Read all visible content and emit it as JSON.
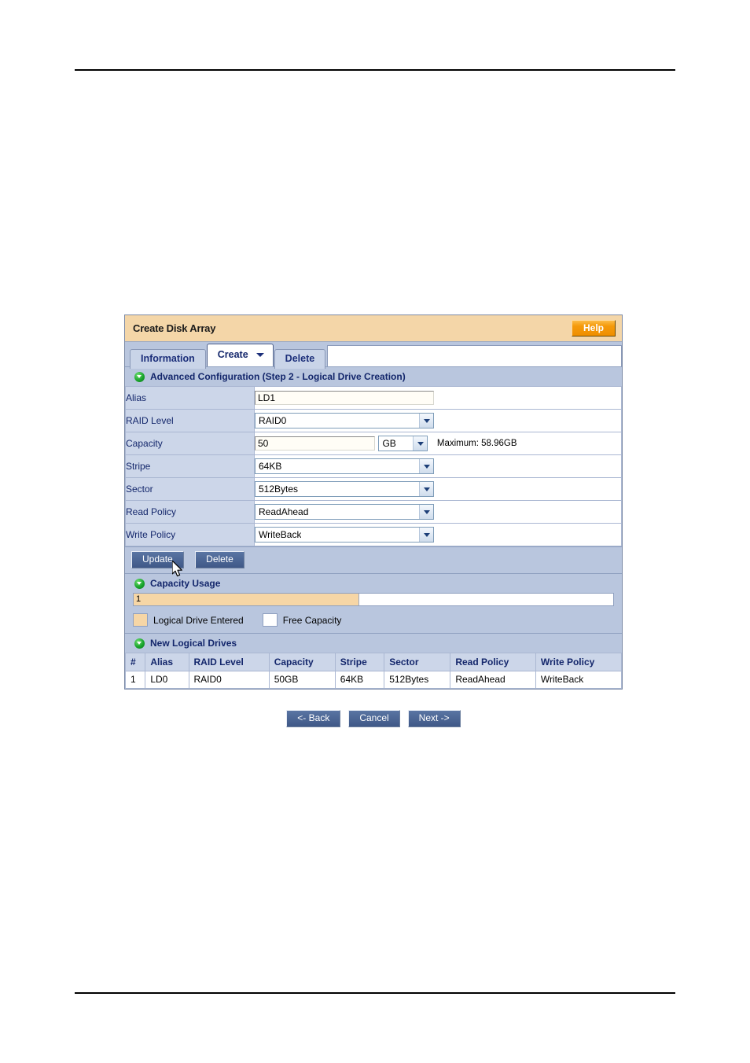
{
  "panel": {
    "title": "Create Disk Array",
    "help_label": "Help"
  },
  "tabs": [
    {
      "label": "Information",
      "active": false
    },
    {
      "label": "Create",
      "active": true,
      "has_dropdown": true
    },
    {
      "label": "Delete",
      "active": false
    }
  ],
  "sections": {
    "advanced_configuration": {
      "title": "Advanced Configuration (Step 2 - Logical Drive Creation)",
      "icon": "collapse-green-icon"
    },
    "capacity_usage": {
      "title": "Capacity Usage",
      "icon": "collapse-green-icon"
    },
    "new_logical_drives": {
      "title": "New Logical Drives",
      "icon": "collapse-green-icon"
    }
  },
  "form": {
    "alias": {
      "label": "Alias",
      "value": "LD1"
    },
    "raid_level": {
      "label": "RAID Level",
      "value": "RAID0"
    },
    "capacity": {
      "label": "Capacity",
      "value": "50",
      "unit": "GB",
      "maximum_text": "Maximum: 58.96GB"
    },
    "stripe": {
      "label": "Stripe",
      "value": "64KB"
    },
    "sector": {
      "label": "Sector",
      "value": "512Bytes"
    },
    "read_policy": {
      "label": "Read Policy",
      "value": "ReadAhead"
    },
    "write_policy": {
      "label": "Write Policy",
      "value": "WriteBack"
    },
    "update_button": "Update",
    "delete_button": "Delete"
  },
  "capacity_usage": {
    "used_label": "1",
    "used_percent": 47,
    "legend": [
      {
        "label": "Logical Drive Entered",
        "color": "#f6d6a6"
      },
      {
        "label": "Free Capacity",
        "color": "#ffffff"
      }
    ]
  },
  "new_logical_drives": {
    "columns": [
      "#",
      "Alias",
      "RAID Level",
      "Capacity",
      "Stripe",
      "Sector",
      "Read Policy",
      "Write Policy"
    ],
    "rows": [
      [
        "1",
        "LD0",
        "RAID0",
        "50GB",
        "64KB",
        "512Bytes",
        "ReadAhead",
        "WriteBack"
      ]
    ]
  },
  "footer": {
    "back_label": "<- Back",
    "cancel_label": "Cancel",
    "next_label": "Next ->"
  },
  "colors": {
    "panel_bg": "#b9c6de",
    "titlebar_bg": "#f4d6a8",
    "help_orange": "#f59a0b",
    "label_blue": "#13266b",
    "row_label_bg": "#ccd6e9",
    "button_blue": "#4a6593",
    "used_capacity": "#f6d6a6"
  }
}
